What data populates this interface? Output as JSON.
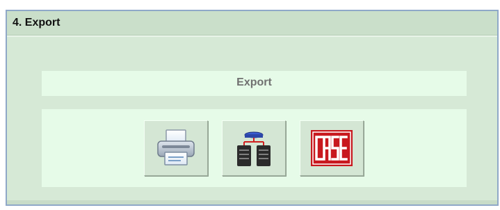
{
  "panel": {
    "title": "4. Export"
  },
  "export_section": {
    "label": "Export"
  },
  "buttons": [
    {
      "icon": "printer-icon"
    },
    {
      "icon": "server-network-icon"
    },
    {
      "icon": "case-logo-icon",
      "logo_text": "CASE"
    }
  ],
  "colors": {
    "panel_background": "#d6e9d6",
    "header_background": "#cadfca",
    "section_background": "#e6fbe8",
    "panel_border": "#8fa8c8",
    "case_red": "#c8181e"
  }
}
